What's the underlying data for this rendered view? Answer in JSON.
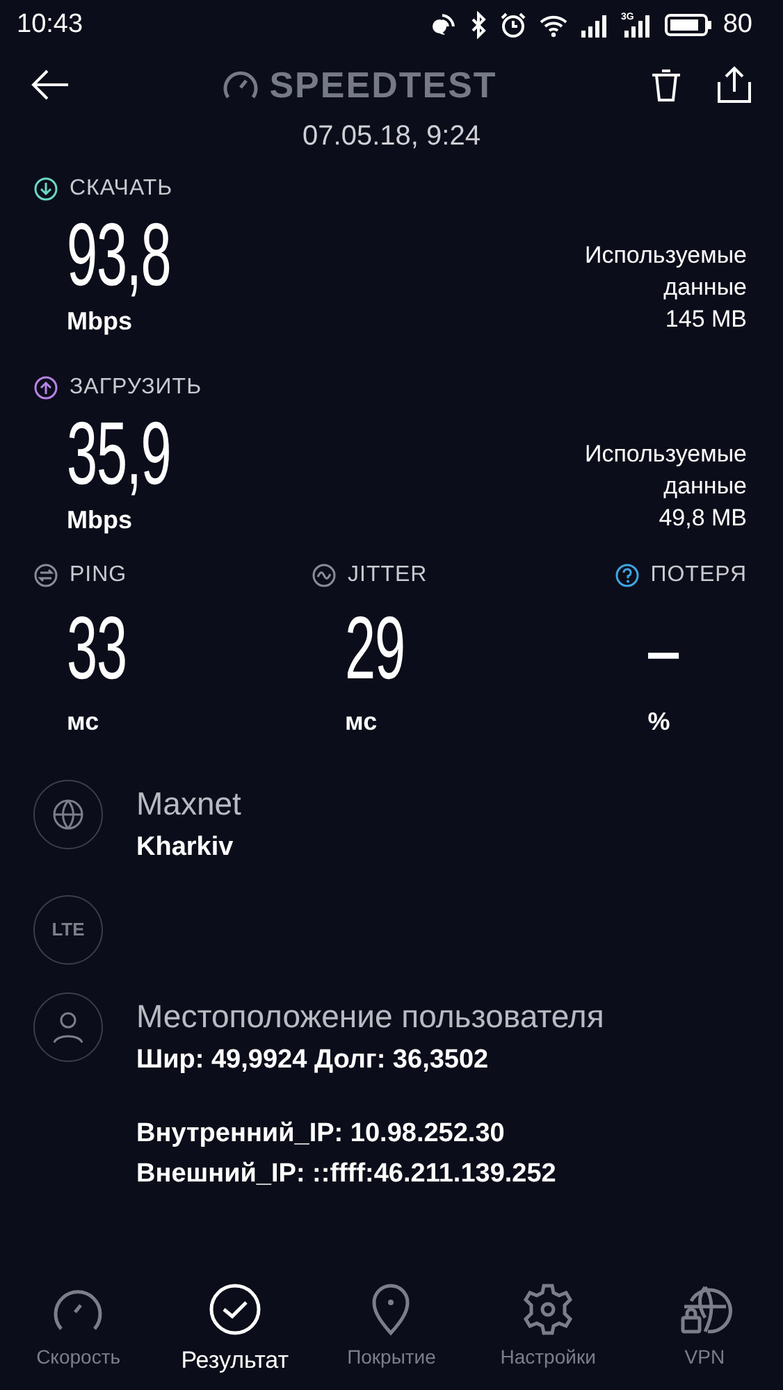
{
  "status_bar": {
    "time": "10:43",
    "network": "3G",
    "battery": "80"
  },
  "header": {
    "title": "SPEEDTEST",
    "date": "07.05.18, 9:24"
  },
  "speeds": [
    {
      "kind": "download",
      "color": "#6ad8c6",
      "label": "СКАЧАТЬ",
      "value": "93,8",
      "unit": "Mbps",
      "data_label": "Используемые данные",
      "data_value": "145 MB"
    },
    {
      "kind": "upload",
      "color": "#b884e6",
      "label": "ЗАГРУЗИТЬ",
      "value": "35,9",
      "unit": "Mbps",
      "data_label": "Используемые данные",
      "data_value": "49,8 MB"
    }
  ],
  "metrics": [
    {
      "kind": "ping",
      "color": "#8a8d99",
      "label": "PING",
      "value": "33",
      "unit": "мс"
    },
    {
      "kind": "jitter",
      "color": "#8a8d99",
      "label": "JITTER",
      "value": "29",
      "unit": "мс"
    },
    {
      "kind": "loss",
      "color": "#3fa6e6",
      "label": "ПОТЕРЯ",
      "value": "–",
      "unit": "%"
    }
  ],
  "info": [
    {
      "kind": "provider",
      "title": "Maxnet",
      "lines": [
        "Kharkiv"
      ]
    },
    {
      "kind": "connection",
      "icon_text": "LTE"
    },
    {
      "kind": "location",
      "title": "Местоположение пользователя",
      "lines": [
        "Шир: 49,9924 Долг: 36,3502"
      ],
      "ip_lines": [
        "Внутренний_IP: 10.98.252.30",
        "Внешний_IP: ::ffff:46.211.139.252"
      ]
    }
  ],
  "nav": [
    {
      "kind": "speed",
      "label": "Скорость",
      "selected": false
    },
    {
      "kind": "result",
      "label": "Результат",
      "selected": true
    },
    {
      "kind": "coverage",
      "label": "Покрытие",
      "selected": false
    },
    {
      "kind": "settings",
      "label": "Настройки",
      "selected": false
    },
    {
      "kind": "vpn",
      "label": "VPN",
      "selected": false
    }
  ]
}
